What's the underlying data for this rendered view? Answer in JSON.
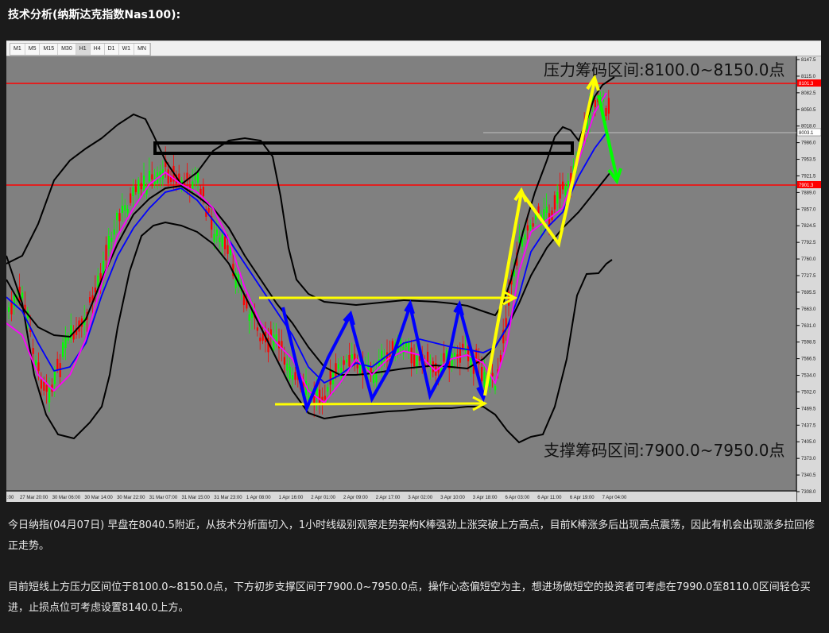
{
  "heading": "技术分析(纳斯达克指数Nas100):",
  "timeframes": [
    "M1",
    "M5",
    "M15",
    "M30",
    "H1",
    "H4",
    "D1",
    "W1",
    "MN"
  ],
  "active_timeframe": "H1",
  "resistance_label": "压力筹码区间:8100.0~8150.0点",
  "support_label": "支撑筹码区间:7900.0~7950.0点",
  "price_axis": [
    "8147.5",
    "8115.0",
    "8082.5",
    "8050.5",
    "8018.0",
    "7986.0",
    "7953.5",
    "7921.5",
    "7889.0",
    "7857.0",
    "7824.5",
    "7792.5",
    "7760.0",
    "7727.5",
    "7695.5",
    "7663.0",
    "7631.0",
    "7598.5",
    "7566.5",
    "7534.0",
    "7502.0",
    "7469.5",
    "7437.5",
    "7405.0",
    "7373.0",
    "7340.5",
    "7308.0"
  ],
  "price_tags": {
    "upper_line": "8101.3",
    "current": "8003.1",
    "lower_line": "7901.3"
  },
  "time_axis": [
    ":00",
    "27 Mar 20:00",
    "30 Mar 06:00",
    "30 Mar 14:00",
    "30 Mar 22:00",
    "31 Mar 07:00",
    "31 Mar 15:00",
    "31 Mar 23:00",
    "1 Apr 08:00",
    "1 Apr 16:00",
    "2 Apr 01:00",
    "2 Apr 09:00",
    "2 Apr 17:00",
    "3 Apr 02:00",
    "3 Apr 10:00",
    "3 Apr 18:00",
    "6 Apr 03:00",
    "6 Apr 11:00",
    "6 Apr 19:00",
    "7 Apr 04:00"
  ],
  "colors": {
    "background": "#808080",
    "bull_candle": "#00ff00",
    "bear_candle": "#ff0000",
    "bollinger": "#000000",
    "ma_fast": "#ff00ff",
    "ma_slow": "#0000ff",
    "level_line": "#ff0000",
    "arrow_yellow": "#ffff00",
    "arrow_blue": "#0000ff",
    "arrow_green": "#00ff00"
  },
  "paragraph_1": "今日纳指(04月07日) 早盘在8040.5附近，从技术分析面切入，1小时线级别观察走势架构K棒强劲上涨突破上方高点，目前K棒涨多后出现高点震荡，因此有机会出现涨多拉回修正走势。",
  "paragraph_2": "目前短线上方压力区间位于8100.0~8150.0点，下方初步支撑区间于7900.0~7950.0点，操作心态偏短空为主，想进场做短空的投资者可考虑在7990.0至8110.0区间轻仓买进，止损点位可考虑设置8140.0上方。"
}
